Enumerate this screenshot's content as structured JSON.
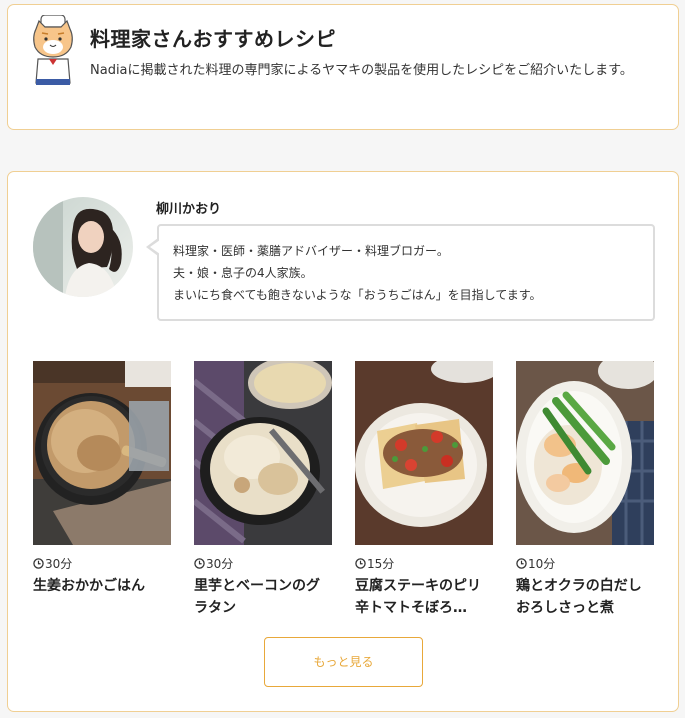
{
  "header": {
    "title": "料理家さんおすすめレシピ",
    "description": "Nadiaに掲載された料理の専門家によるヤマキの製品を使用したレシピをご紹介いたします。"
  },
  "chef": {
    "name": "柳川かおり",
    "bio": [
      "料理家・医師・薬膳アドバイザー・料理ブロガー。",
      "夫・娘・息子の4人家族。",
      "まいにち食べても飽きないような「おうちごはん」を目指してます。"
    ]
  },
  "recipes": [
    {
      "time": "30分",
      "title": "生姜おかかごはん"
    },
    {
      "time": "30分",
      "title": "里芋とベーコンのグラタン"
    },
    {
      "time": "15分",
      "title": "豆腐ステーキのピリ辛トマトそぼろ…"
    },
    {
      "time": "10分",
      "title": "鶏とオクラの白だしおろしさっと煮"
    }
  ],
  "more_button": "もっと見る",
  "colors": {
    "accent": "#e8a83a",
    "card_border": "#f0cf93",
    "bubble_border": "#dcdcdc"
  },
  "icons": {
    "mascot": "cat-chef-mascot",
    "time": "clock-icon"
  }
}
